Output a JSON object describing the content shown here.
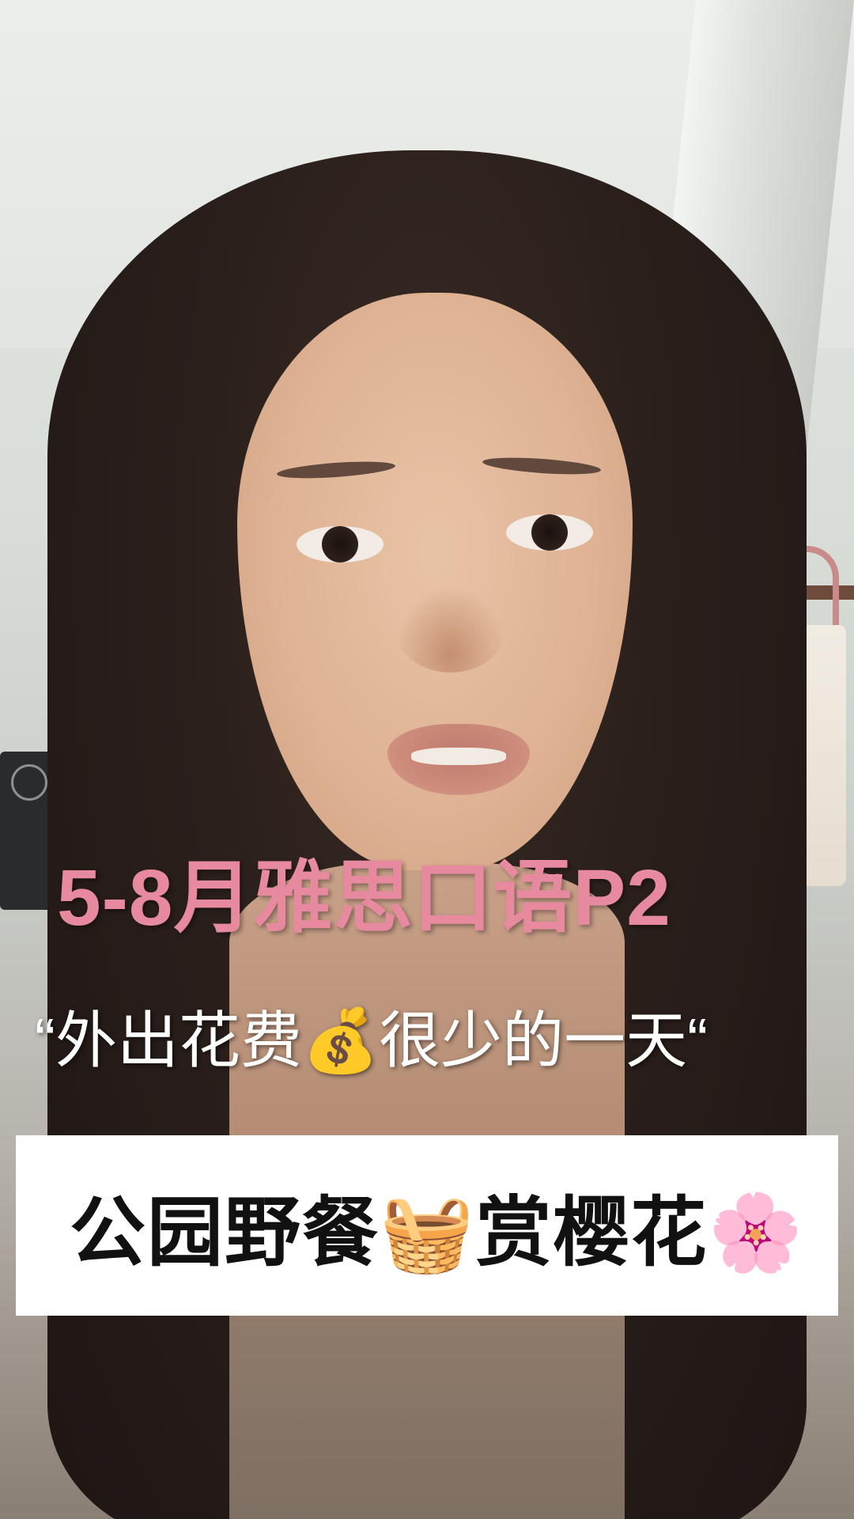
{
  "captions": {
    "title": "5-8月雅思口语P2",
    "subtitle": "“外出花费💰很少的一天“",
    "banner": "公园野餐🧺赏樱花🌸"
  },
  "colors": {
    "title_pink": "#e78aa0",
    "subtitle_white": "#ffffff",
    "banner_background": "#ffffff",
    "banner_text": "#111111"
  }
}
